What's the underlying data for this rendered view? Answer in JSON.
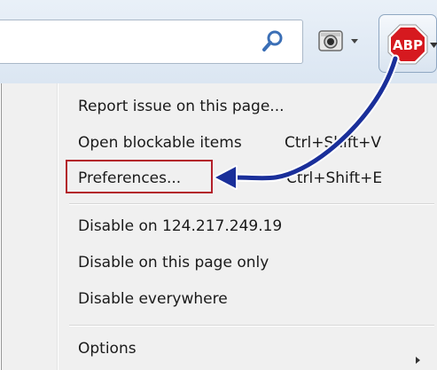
{
  "toolbar": {
    "search_icon": "search-icon",
    "camera_icon": "camera-icon",
    "abp_icon_text": "ABP"
  },
  "menu": {
    "items": [
      {
        "label": "Report issue on this page...",
        "shortcut": ""
      },
      {
        "label": "Open blockable items",
        "shortcut": "Ctrl+Shift+V"
      },
      {
        "label": "Preferences...",
        "shortcut": "Ctrl+Shift+E"
      },
      {
        "label": "Disable on 124.217.249.19",
        "shortcut": ""
      },
      {
        "label": "Disable on this page only",
        "shortcut": ""
      },
      {
        "label": "Disable everywhere",
        "shortcut": ""
      },
      {
        "label": "Options",
        "shortcut": ""
      }
    ]
  },
  "annotation": {
    "arrow_color": "#1a2f9a",
    "highlight_color": "#b3202a"
  }
}
